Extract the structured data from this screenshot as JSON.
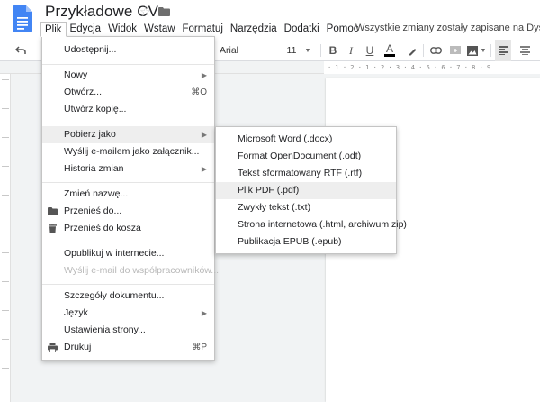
{
  "app": {
    "title": "Przykładowe CV",
    "save_status": "Wszystkie zmiany zostały zapisane na Dysku",
    "accent": "#4285f4"
  },
  "menubar": [
    {
      "label": "Plik",
      "active": true
    },
    {
      "label": "Edycja"
    },
    {
      "label": "Widok"
    },
    {
      "label": "Wstaw"
    },
    {
      "label": "Formatuj"
    },
    {
      "label": "Narzędzia"
    },
    {
      "label": "Dodatki"
    },
    {
      "label": "Pomoc"
    }
  ],
  "toolbar": {
    "font": "Arial",
    "font_size": "11",
    "bold": "B",
    "italic": "I",
    "underline": "U",
    "text_color": "A",
    "text_color_bar": "#000000"
  },
  "ruler": {
    "ticks": "· 1 · 2 · 1 · 2 · 3 · 4 · 5 · 6 · 7 · 8 · 9"
  },
  "file_menu": {
    "items": [
      {
        "label": "Udostępnij..."
      },
      {
        "label": "Nowy",
        "submenu": true
      },
      {
        "label": "Otwórz...",
        "shortcut": "⌘O"
      },
      {
        "label": "Utwórz kopię..."
      },
      {
        "label": "Pobierz jako",
        "submenu": true,
        "highlighted": true
      },
      {
        "label": "Wyślij e-mailem jako załącznik..."
      },
      {
        "label": "Historia zmian",
        "submenu": true
      },
      {
        "label": "Zmień nazwę..."
      },
      {
        "label": "Przenieś do...",
        "icon": "folder-icon"
      },
      {
        "label": "Przenieś do kosza",
        "icon": "trash-icon"
      },
      {
        "label": "Opublikuj w internecie..."
      },
      {
        "label": "Wyślij e-mail do współpracowników...",
        "disabled": true
      },
      {
        "label": "Szczegóły dokumentu..."
      },
      {
        "label": "Język",
        "submenu": true
      },
      {
        "label": "Ustawienia strony..."
      },
      {
        "label": "Drukuj",
        "shortcut": "⌘P",
        "icon": "print-icon"
      }
    ]
  },
  "download_menu": {
    "items": [
      {
        "label": "Microsoft Word (.docx)"
      },
      {
        "label": "Format OpenDocument (.odt)"
      },
      {
        "label": "Tekst sformatowany RTF (.rtf)"
      },
      {
        "label": "Plik PDF (.pdf)",
        "highlighted": true
      },
      {
        "label": "Zwykły tekst (.txt)"
      },
      {
        "label": "Strona internetowa (.html, archiwum zip)"
      },
      {
        "label": "Publikacja EPUB (.epub)"
      }
    ]
  }
}
